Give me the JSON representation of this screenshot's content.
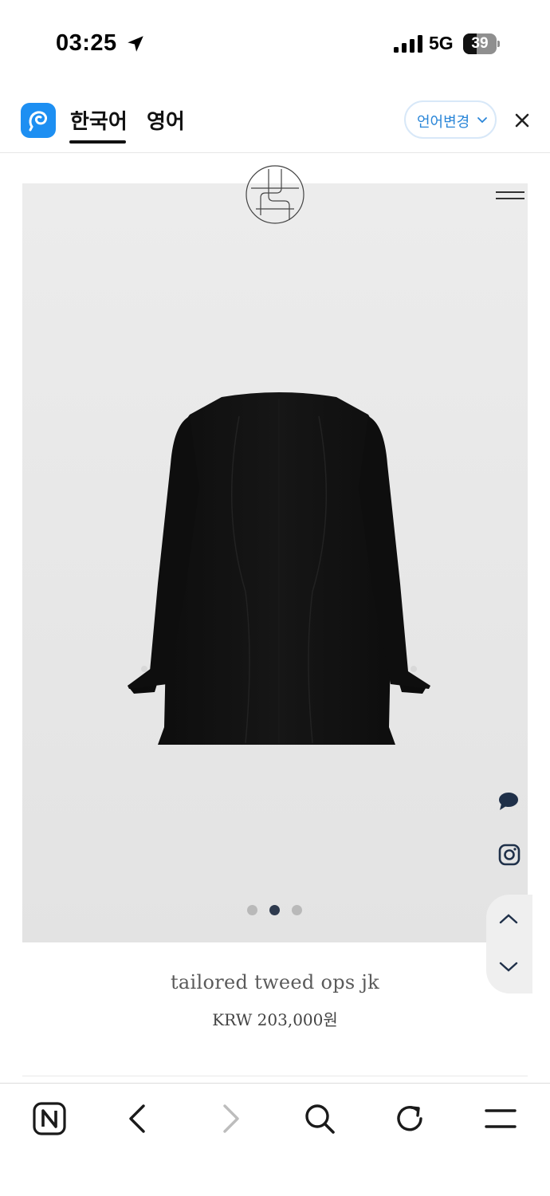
{
  "status_bar": {
    "time": "03:25",
    "network": "5G",
    "battery": "39"
  },
  "translation_bar": {
    "source_lang": "한국어",
    "target_lang": "영어",
    "change_label": "언어변경"
  },
  "gallery": {
    "slide_count": 3,
    "active_slide": 2
  },
  "product": {
    "name": "tailored tweed ops jk",
    "price": "KRW 203,000원"
  },
  "icons": {
    "location": "location-arrow-icon",
    "signal": "signal-bars-icon",
    "translate_app": "papago-logo-icon",
    "close": "close-icon",
    "brand": "brand-logo-icon",
    "menu": "hamburger-menu-icon",
    "chat": "chat-bubble-icon",
    "instagram": "instagram-icon",
    "scroll_up": "chevron-up-icon",
    "scroll_down": "chevron-down-icon",
    "naver": "naver-n-icon",
    "back": "back-icon",
    "forward": "forward-icon",
    "search": "search-icon",
    "reload": "reload-icon",
    "browser_menu": "menu-icon"
  },
  "colors": {
    "accent": "#1d8ff2",
    "link": "#2a86d8",
    "active_dot": "#2e3a4e",
    "inactive_dot": "#b9b9b9"
  }
}
